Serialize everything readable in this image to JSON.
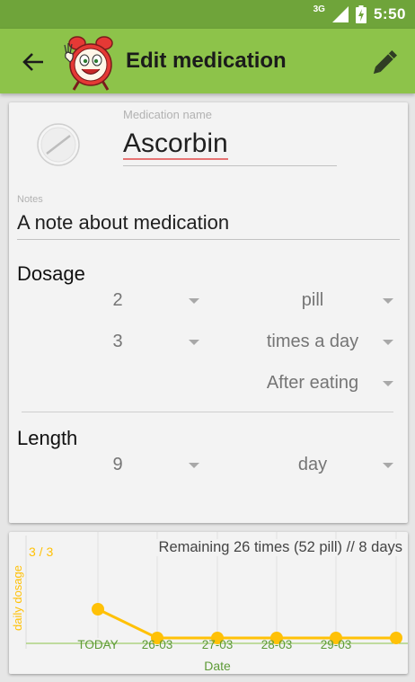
{
  "status_bar": {
    "network": "3G",
    "time": "5:50"
  },
  "toolbar": {
    "title": "Edit medication"
  },
  "medication": {
    "name_label": "Medication name",
    "name": "Ascorbin",
    "notes_label": "Notes",
    "notes": "A note about medication"
  },
  "dosage": {
    "title": "Dosage",
    "amount": "2",
    "unit": "pill",
    "times": "3",
    "frequency": "times a day",
    "timing": "After eating"
  },
  "length": {
    "title": "Length",
    "value": "9",
    "unit": "day"
  },
  "remaining": "Remaining 26 times (52 pill) // 8 days",
  "chart_data": {
    "type": "line",
    "categories": [
      "TODAY",
      "26-03",
      "27-03",
      "28-03",
      "29-03",
      ""
    ],
    "values": [
      1,
      0,
      0,
      0,
      0,
      0
    ],
    "ylabel": "daily dosage",
    "xlabel": "Date",
    "y_max_label": "3 / 3",
    "ylim": [
      0,
      3
    ],
    "grid": true,
    "colors": {
      "line": "#ffc107",
      "axis": "#8bc34a",
      "text": "#5d9a36"
    }
  }
}
